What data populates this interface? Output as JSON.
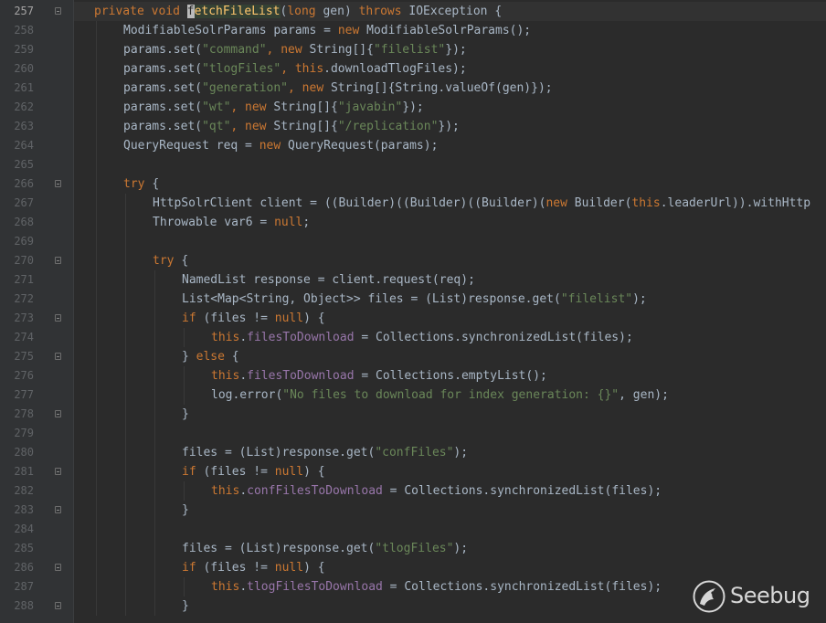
{
  "editor": {
    "colors": {
      "background": "#2b2b2b",
      "keyword": "#cc7832",
      "string": "#6a8759",
      "field": "#9876aa",
      "method_declaration": "#ffc66d",
      "plain": "#a9b7c6",
      "line_number": "#606366"
    },
    "current_line": 257,
    "lines": [
      {
        "num": "257",
        "fold": true,
        "indent": 0,
        "tokens": [
          {
            "t": "k",
            "v": "private void "
          },
          {
            "t": "caret",
            "v": "f"
          },
          {
            "t": "fh",
            "v": "etchFileList"
          },
          {
            "t": "p",
            "v": "("
          },
          {
            "t": "k",
            "v": "long "
          },
          {
            "t": "p",
            "v": "gen) "
          },
          {
            "t": "k",
            "v": "throws "
          },
          {
            "t": "p",
            "v": "IOException {"
          }
        ]
      },
      {
        "num": "258",
        "fold": false,
        "indent": 1,
        "tokens": [
          {
            "t": "p",
            "v": "ModifiableSolrParams params = "
          },
          {
            "t": "k",
            "v": "new "
          },
          {
            "t": "p",
            "v": "ModifiableSolrParams();"
          }
        ]
      },
      {
        "num": "259",
        "fold": false,
        "indent": 1,
        "tokens": [
          {
            "t": "p",
            "v": "params.set("
          },
          {
            "t": "s",
            "v": "\"command\""
          },
          {
            "t": "k",
            "v": ", new "
          },
          {
            "t": "p",
            "v": "String[]{"
          },
          {
            "t": "s",
            "v": "\"filelist\""
          },
          {
            "t": "p",
            "v": "});"
          }
        ]
      },
      {
        "num": "260",
        "fold": false,
        "indent": 1,
        "tokens": [
          {
            "t": "p",
            "v": "params.set("
          },
          {
            "t": "s",
            "v": "\"tlogFiles\""
          },
          {
            "t": "k",
            "v": ", this"
          },
          {
            "t": "p",
            "v": ".downloadTlogFiles);"
          }
        ]
      },
      {
        "num": "261",
        "fold": false,
        "indent": 1,
        "tokens": [
          {
            "t": "p",
            "v": "params.set("
          },
          {
            "t": "s",
            "v": "\"generation\""
          },
          {
            "t": "k",
            "v": ", new "
          },
          {
            "t": "p",
            "v": "String[]{String.valueOf(gen)});"
          }
        ]
      },
      {
        "num": "262",
        "fold": false,
        "indent": 1,
        "tokens": [
          {
            "t": "p",
            "v": "params.set("
          },
          {
            "t": "s",
            "v": "\"wt\""
          },
          {
            "t": "k",
            "v": ", new "
          },
          {
            "t": "p",
            "v": "String[]{"
          },
          {
            "t": "s",
            "v": "\"javabin\""
          },
          {
            "t": "p",
            "v": "});"
          }
        ]
      },
      {
        "num": "263",
        "fold": false,
        "indent": 1,
        "tokens": [
          {
            "t": "p",
            "v": "params.set("
          },
          {
            "t": "s",
            "v": "\"qt\""
          },
          {
            "t": "k",
            "v": ", new "
          },
          {
            "t": "p",
            "v": "String[]{"
          },
          {
            "t": "s",
            "v": "\"/replication\""
          },
          {
            "t": "p",
            "v": "});"
          }
        ]
      },
      {
        "num": "264",
        "fold": false,
        "indent": 1,
        "tokens": [
          {
            "t": "p",
            "v": "QueryRequest req = "
          },
          {
            "t": "k",
            "v": "new "
          },
          {
            "t": "p",
            "v": "QueryRequest(params);"
          }
        ]
      },
      {
        "num": "265",
        "fold": false,
        "indent": 1,
        "tokens": []
      },
      {
        "num": "266",
        "fold": true,
        "indent": 1,
        "tokens": [
          {
            "t": "k",
            "v": "try "
          },
          {
            "t": "p",
            "v": "{"
          }
        ]
      },
      {
        "num": "267",
        "fold": false,
        "indent": 2,
        "tokens": [
          {
            "t": "p",
            "v": "HttpSolrClient client = ((Builder)((Builder)((Builder)("
          },
          {
            "t": "k",
            "v": "new "
          },
          {
            "t": "p",
            "v": "Builder("
          },
          {
            "t": "k",
            "v": "this"
          },
          {
            "t": "p",
            "v": ".leaderUrl)).withHttp"
          }
        ]
      },
      {
        "num": "268",
        "fold": false,
        "indent": 2,
        "tokens": [
          {
            "t": "p",
            "v": "Throwable var6 = "
          },
          {
            "t": "k",
            "v": "null"
          },
          {
            "t": "p",
            "v": ";"
          }
        ]
      },
      {
        "num": "269",
        "fold": false,
        "indent": 2,
        "tokens": []
      },
      {
        "num": "270",
        "fold": true,
        "indent": 2,
        "tokens": [
          {
            "t": "k",
            "v": "try "
          },
          {
            "t": "p",
            "v": "{"
          }
        ]
      },
      {
        "num": "271",
        "fold": false,
        "indent": 3,
        "tokens": [
          {
            "t": "p",
            "v": "NamedList response = client.request(req);"
          }
        ]
      },
      {
        "num": "272",
        "fold": false,
        "indent": 3,
        "tokens": [
          {
            "t": "p",
            "v": "List<Map<String, Object>> files = (List)response.get("
          },
          {
            "t": "s",
            "v": "\"filelist\""
          },
          {
            "t": "p",
            "v": ");"
          }
        ]
      },
      {
        "num": "273",
        "fold": true,
        "indent": 3,
        "tokens": [
          {
            "t": "k",
            "v": "if "
          },
          {
            "t": "p",
            "v": "(files != "
          },
          {
            "t": "k",
            "v": "null"
          },
          {
            "t": "p",
            "v": ") {"
          }
        ]
      },
      {
        "num": "274",
        "fold": false,
        "indent": 4,
        "tokens": [
          {
            "t": "k",
            "v": "this"
          },
          {
            "t": "p",
            "v": "."
          },
          {
            "t": "f",
            "v": "filesToDownload"
          },
          {
            "t": "p",
            "v": " = Collections.synchronizedList(files);"
          }
        ]
      },
      {
        "num": "275",
        "fold": true,
        "indent": 3,
        "tokens": [
          {
            "t": "p",
            "v": "} "
          },
          {
            "t": "k",
            "v": "else "
          },
          {
            "t": "p",
            "v": "{"
          }
        ]
      },
      {
        "num": "276",
        "fold": false,
        "indent": 4,
        "tokens": [
          {
            "t": "k",
            "v": "this"
          },
          {
            "t": "p",
            "v": "."
          },
          {
            "t": "f",
            "v": "filesToDownload"
          },
          {
            "t": "p",
            "v": " = Collections.emptyList();"
          }
        ]
      },
      {
        "num": "277",
        "fold": false,
        "indent": 4,
        "tokens": [
          {
            "t": "p",
            "v": "log.error("
          },
          {
            "t": "s",
            "v": "\"No files to download for index generation: {}\""
          },
          {
            "t": "p",
            "v": ", gen);"
          }
        ]
      },
      {
        "num": "278",
        "fold": true,
        "indent": 3,
        "tokens": [
          {
            "t": "p",
            "v": "}"
          }
        ]
      },
      {
        "num": "279",
        "fold": false,
        "indent": 3,
        "tokens": []
      },
      {
        "num": "280",
        "fold": false,
        "indent": 3,
        "tokens": [
          {
            "t": "p",
            "v": "files = (List)response.get("
          },
          {
            "t": "s",
            "v": "\"confFiles\""
          },
          {
            "t": "p",
            "v": ");"
          }
        ]
      },
      {
        "num": "281",
        "fold": true,
        "indent": 3,
        "tokens": [
          {
            "t": "k",
            "v": "if "
          },
          {
            "t": "p",
            "v": "(files != "
          },
          {
            "t": "k",
            "v": "null"
          },
          {
            "t": "p",
            "v": ") {"
          }
        ]
      },
      {
        "num": "282",
        "fold": false,
        "indent": 4,
        "tokens": [
          {
            "t": "k",
            "v": "this"
          },
          {
            "t": "p",
            "v": "."
          },
          {
            "t": "f",
            "v": "confFilesToDownload"
          },
          {
            "t": "p",
            "v": " = Collections.synchronizedList(files);"
          }
        ]
      },
      {
        "num": "283",
        "fold": true,
        "indent": 3,
        "tokens": [
          {
            "t": "p",
            "v": "}"
          }
        ]
      },
      {
        "num": "284",
        "fold": false,
        "indent": 3,
        "tokens": []
      },
      {
        "num": "285",
        "fold": false,
        "indent": 3,
        "tokens": [
          {
            "t": "p",
            "v": "files = (List)response.get("
          },
          {
            "t": "s",
            "v": "\"tlogFiles\""
          },
          {
            "t": "p",
            "v": ");"
          }
        ]
      },
      {
        "num": "286",
        "fold": true,
        "indent": 3,
        "tokens": [
          {
            "t": "k",
            "v": "if "
          },
          {
            "t": "p",
            "v": "(files != "
          },
          {
            "t": "k",
            "v": "null"
          },
          {
            "t": "p",
            "v": ") {"
          }
        ]
      },
      {
        "num": "287",
        "fold": false,
        "indent": 4,
        "tokens": [
          {
            "t": "k",
            "v": "this"
          },
          {
            "t": "p",
            "v": "."
          },
          {
            "t": "f",
            "v": "tlogFilesToDownload"
          },
          {
            "t": "p",
            "v": " = Collections.synchronizedList(files);"
          }
        ]
      },
      {
        "num": "288",
        "fold": true,
        "indent": 3,
        "tokens": [
          {
            "t": "p",
            "v": "}"
          }
        ]
      }
    ]
  },
  "watermark": {
    "text": "Seebug",
    "icon": "seebug-logo-icon"
  }
}
